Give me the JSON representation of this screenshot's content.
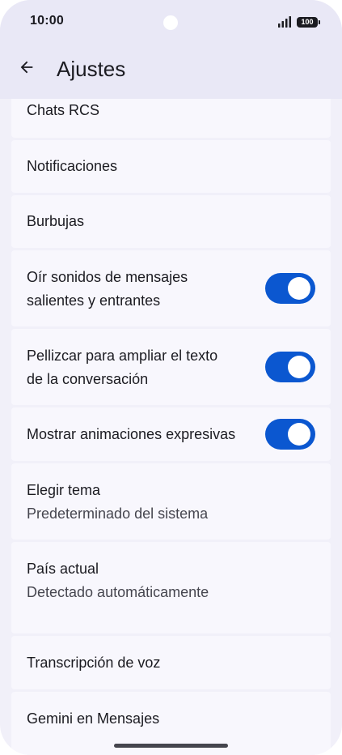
{
  "status_bar": {
    "time": "10:00",
    "battery": "100"
  },
  "app_bar": {
    "title": "Ajustes",
    "back_icon": "arrow-back-icon"
  },
  "settings": {
    "chats_rcs": "Chats RCS",
    "notifications": "Notificaciones",
    "bubbles": "Burbujas",
    "sounds": {
      "line1": "Oír sonidos de mensajes",
      "line2": "salientes y entrantes",
      "enabled": true
    },
    "pinch": {
      "line1": "Pellizcar para ampliar el texto",
      "line2": "de la conversación",
      "enabled": true
    },
    "animations": {
      "label": "Mostrar animaciones expresivas",
      "enabled": true
    },
    "theme": {
      "label": "Elegir tema",
      "value": "Predeterminado del sistema"
    },
    "country": {
      "label": "País actual",
      "value": "Detectado automáticamente"
    },
    "transcription": "Transcripción de voz",
    "gemini": "Gemini en Mensajes"
  },
  "colors": {
    "accent": "#0b57d0",
    "app_bar_bg": "#e9e8f6",
    "card_bg": "#f8f7fd"
  }
}
